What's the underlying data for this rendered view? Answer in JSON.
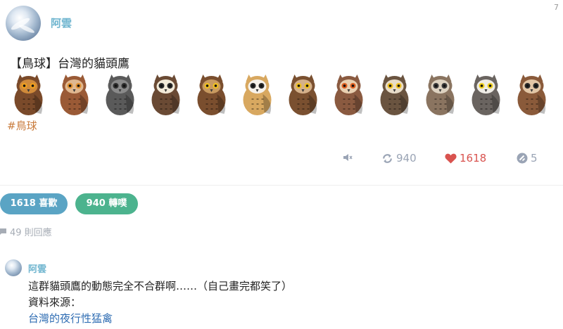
{
  "corner_number": "7",
  "post": {
    "author": "阿雲",
    "title": "【鳥球】台灣的貓頭鷹",
    "hashtag": "#鳥球",
    "owls": [
      {
        "name": "owl-1",
        "body": "#7a4a2a",
        "face": "#d08a3a",
        "eye": "#f0a020"
      },
      {
        "name": "owl-2",
        "body": "#9a5a36",
        "face": "#e0b890",
        "eye": "#e09030"
      },
      {
        "name": "owl-3",
        "body": "#5a5a5a",
        "face": "#8a8a8a",
        "eye": "#303030"
      },
      {
        "name": "owl-4",
        "body": "#6a4a34",
        "face": "#f2ead8",
        "eye": "#2a2a2a"
      },
      {
        "name": "owl-5",
        "body": "#7a4e2e",
        "face": "#c89a60",
        "eye": "#f2c020"
      },
      {
        "name": "owl-6",
        "body": "#d8a860",
        "face": "#f7f2ea",
        "eye": "#2a2a2a"
      },
      {
        "name": "owl-7",
        "body": "#7a5030",
        "face": "#d4b08a",
        "eye": "#f0c020"
      },
      {
        "name": "owl-8",
        "body": "#8a5a40",
        "face": "#e8cfb0",
        "eye": "#e06020"
      },
      {
        "name": "owl-9",
        "body": "#6a5440",
        "face": "#e8dcc8",
        "eye": "#f0c020"
      },
      {
        "name": "owl-10",
        "body": "#8a7460",
        "face": "#ddd2c0",
        "eye": "#3a3a3a"
      },
      {
        "name": "owl-11",
        "body": "#6a6460",
        "face": "#efece6",
        "eye": "#f0d020"
      },
      {
        "name": "owl-12",
        "body": "#8a5a3a",
        "face": "#e2c6a6",
        "eye": "#2a2a2a"
      }
    ],
    "actions": {
      "mute_icon": "speaker-icon",
      "reblog_count": "940",
      "like_count": "1618",
      "reply_count": "5"
    }
  },
  "stats": {
    "likes_label": "1618 喜歡",
    "reblogs_label": "940 轉噗",
    "replies_label": "49 則回應"
  },
  "comment": {
    "author": "阿雲",
    "line1": "這群貓頭鷹的動態完全不合群啊……（自己畫完都笑了）",
    "line2": "資料來源：",
    "link": "台灣的夜行性猛禽"
  },
  "colors": {
    "accent": "#6fb5cf",
    "like": "#d9534f",
    "likes_pill": "#5aa4c4",
    "reblogs_pill": "#4cb38e",
    "hashtag": "#c87a3a"
  }
}
